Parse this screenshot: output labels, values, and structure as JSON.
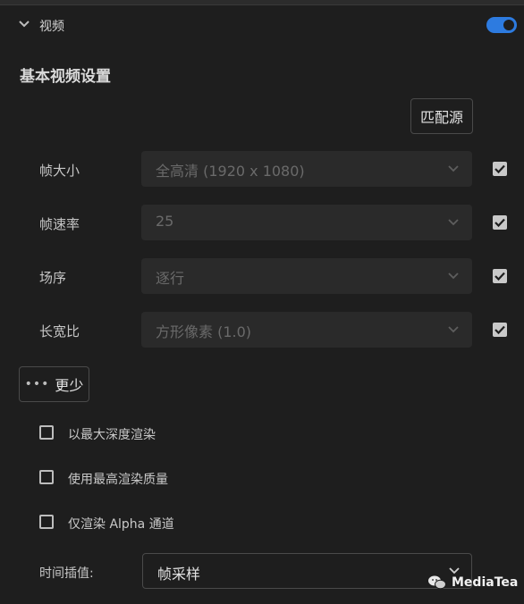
{
  "section": {
    "title": "视频",
    "enabled": true
  },
  "settings": {
    "heading": "基本视频设置",
    "match_source_label": "匹配源",
    "rows": [
      {
        "label": "帧大小",
        "value": "全高清 (1920 x 1080)",
        "checked": true
      },
      {
        "label": "帧速率",
        "value": "25",
        "checked": true
      },
      {
        "label": "场序",
        "value": "逐行",
        "checked": true
      },
      {
        "label": "长宽比",
        "value": "方形像素 (1.0)",
        "checked": true
      }
    ],
    "less_label": "更少",
    "less_dots": "•••"
  },
  "options": [
    {
      "label": "以最大深度渲染",
      "checked": false
    },
    {
      "label": "使用最高渲染质量",
      "checked": false
    },
    {
      "label": "仅渲染 Alpha 通道",
      "checked": false
    }
  ],
  "interpolation": {
    "label": "时间插值:",
    "value": "帧采样"
  },
  "watermark": {
    "text": "MediaTea"
  },
  "colors": {
    "accent": "#2d7be0",
    "background": "#1e1e1e",
    "field": "#2a2a2a"
  }
}
